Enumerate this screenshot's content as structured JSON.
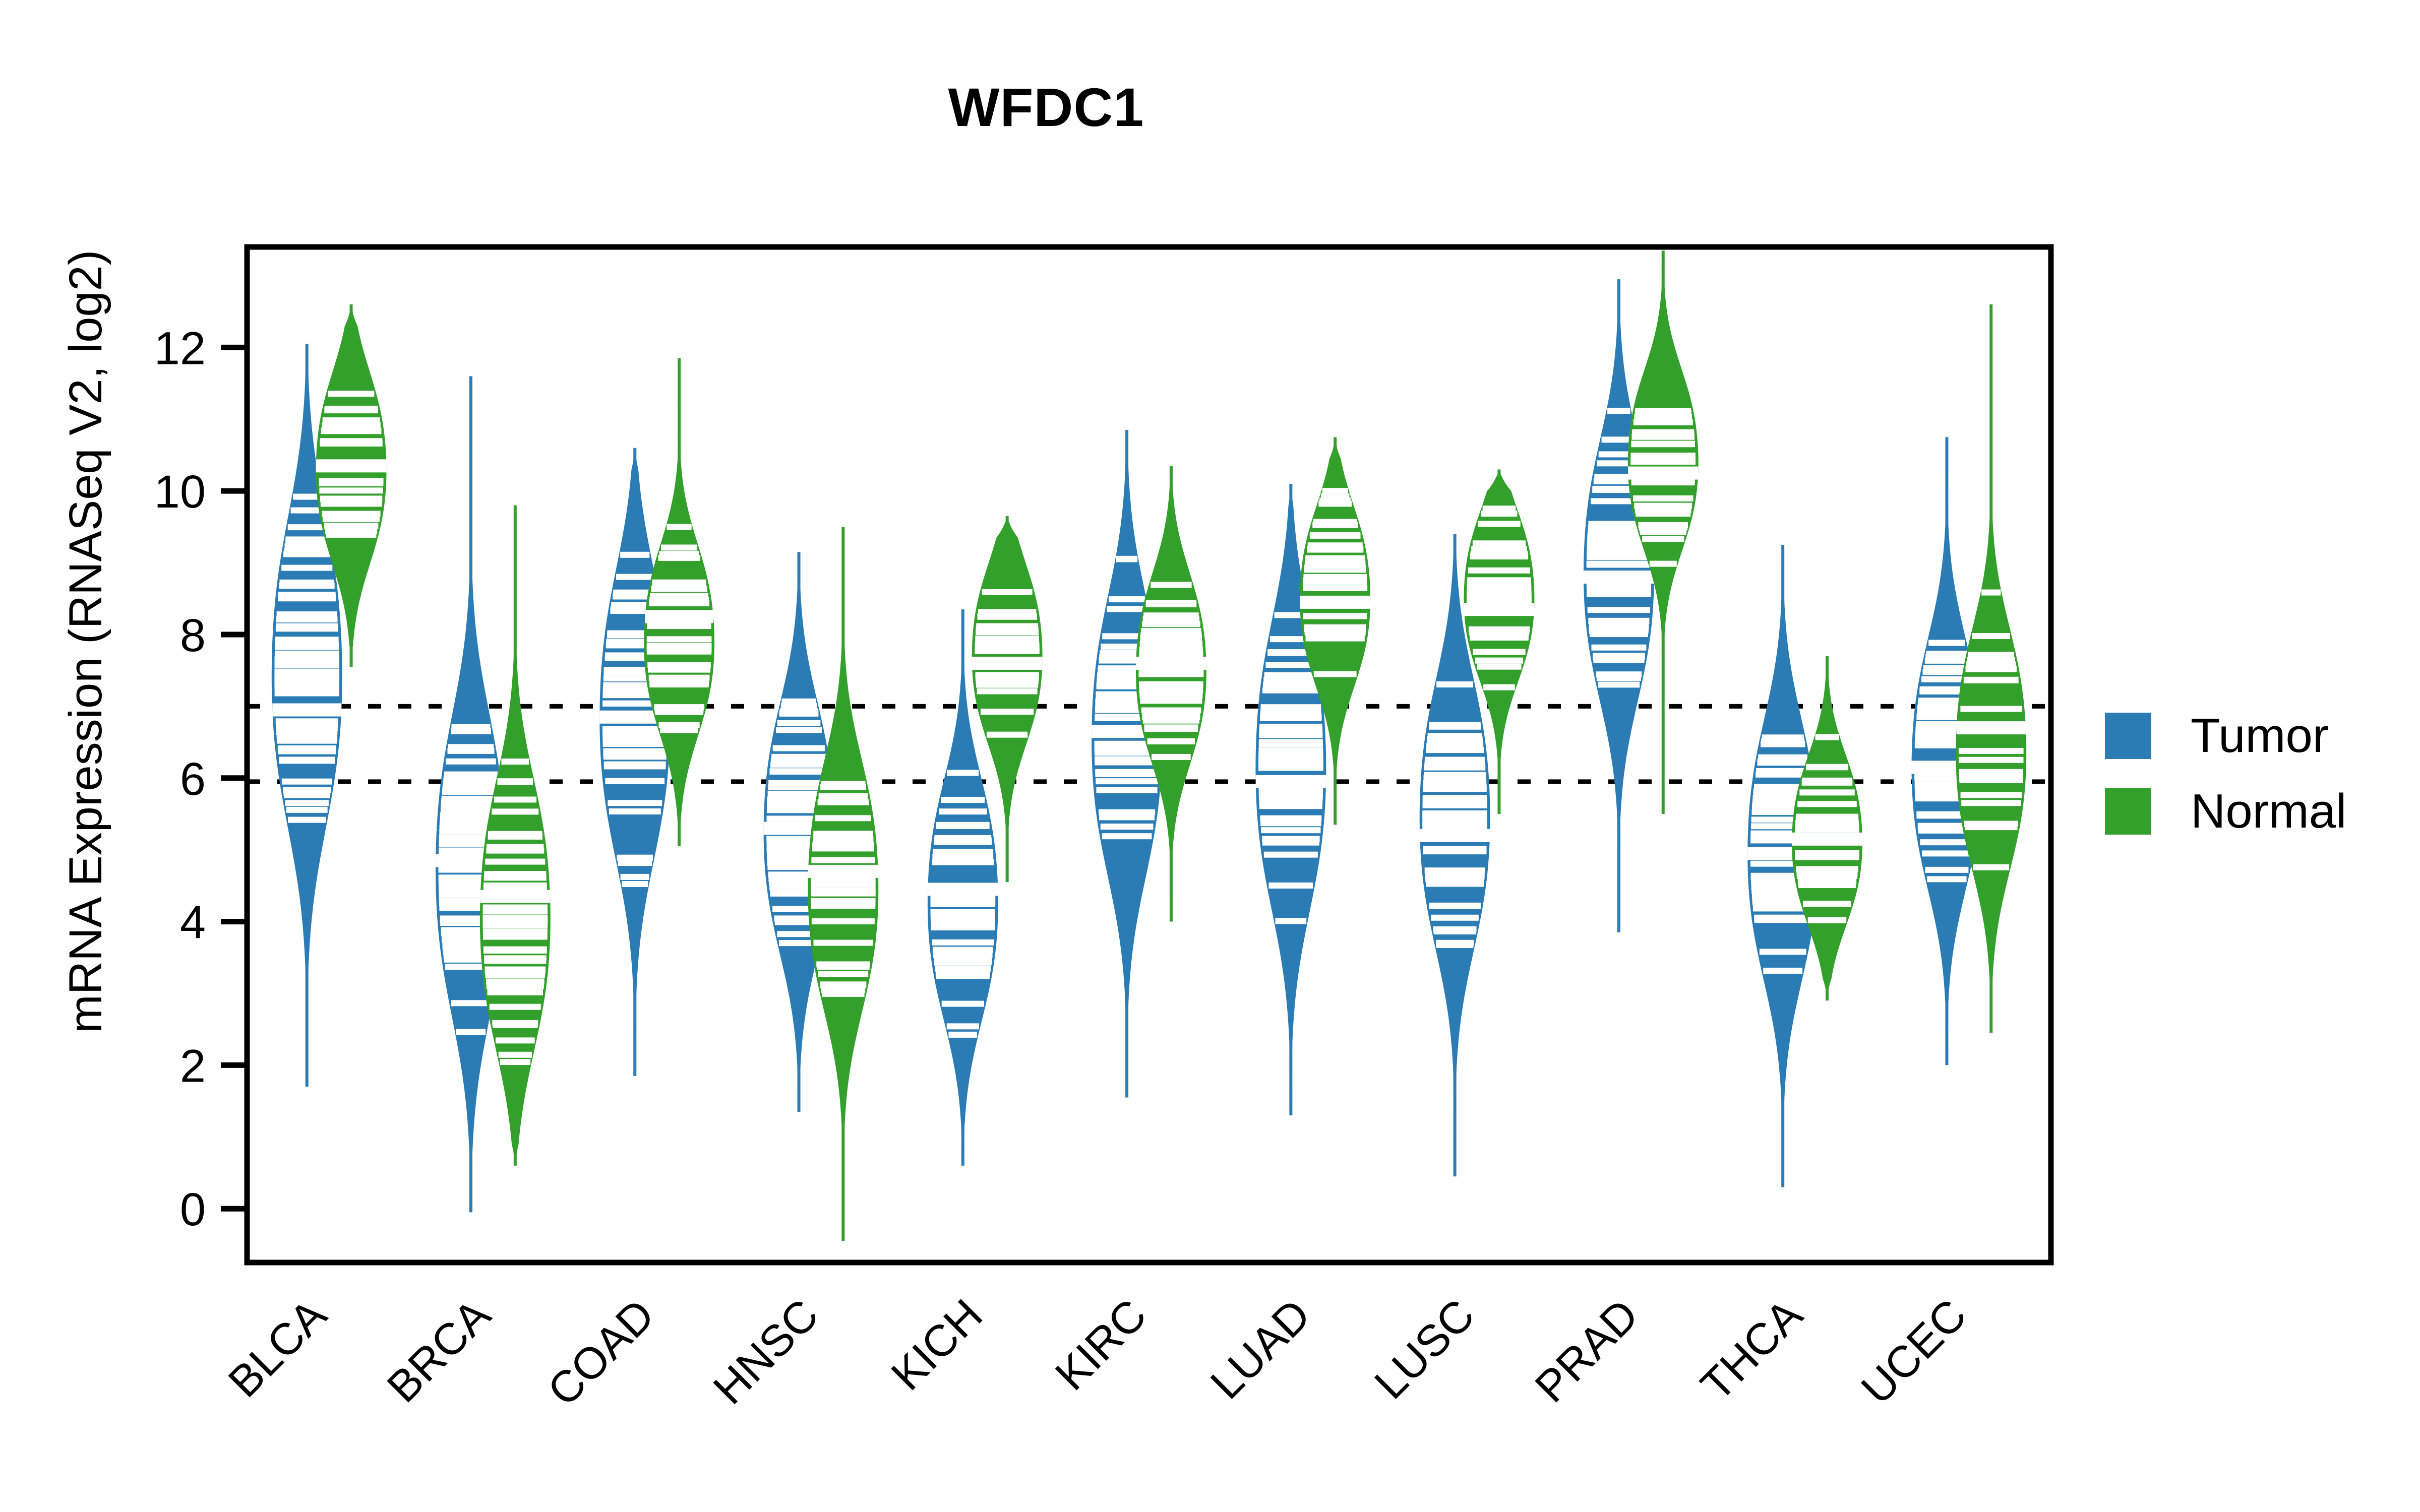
{
  "chart_data": {
    "type": "violin",
    "title": "WFDC1",
    "xlabel": "",
    "ylabel": "mRNA Expression (RNASeq V2, log2)",
    "ylim": [
      -0.75,
      13.4
    ],
    "yticks": [
      0,
      2,
      4,
      6,
      8,
      10,
      12
    ],
    "ytick_labels": [
      "0",
      "2",
      "4",
      "6",
      "8",
      "10",
      "12"
    ],
    "grid": false,
    "legend_position": "right",
    "reference_lines": [
      7.0,
      5.95
    ],
    "categories": [
      "BLCA",
      "BRCA",
      "COAD",
      "HNSC",
      "KICH",
      "KIRC",
      "LUAD",
      "LUSC",
      "PRAD",
      "THCA",
      "UCEC"
    ],
    "legend": [
      {
        "name": "Tumor",
        "color": "#2b7cb5"
      },
      {
        "name": "Normal",
        "color": "#33a02c"
      }
    ],
    "series": [
      {
        "name": "Tumor",
        "color": "#2b7cb5",
        "groups": [
          {
            "category": "BLCA",
            "median": 6.95,
            "min": 1.7,
            "max": 12.05,
            "q1": 5.45,
            "q3": 8.45,
            "mode": 7.6,
            "spread": 1.55,
            "n_ticks": 62
          },
          {
            "category": "BRCA",
            "median": 4.85,
            "min": -0.05,
            "max": 11.6,
            "q1": 3.6,
            "q3": 6.25,
            "mode": 4.9,
            "spread": 1.5,
            "n_ticks": 74
          },
          {
            "category": "COAD",
            "median": 6.85,
            "min": 1.85,
            "max": 10.6,
            "q1": 5.6,
            "q3": 8.05,
            "mode": 7.0,
            "spread": 1.45,
            "n_ticks": 60
          },
          {
            "category": "HNSC",
            "median": 5.3,
            "min": 1.35,
            "max": 9.15,
            "q1": 4.1,
            "q3": 6.1,
            "mode": 5.4,
            "spread": 1.25,
            "n_ticks": 58
          },
          {
            "category": "KICH",
            "median": 4.45,
            "min": 0.6,
            "max": 8.35,
            "q1": 3.55,
            "q3": 5.55,
            "mode": 4.4,
            "spread": 1.2,
            "n_ticks": 42
          },
          {
            "category": "KIRC",
            "median": 6.65,
            "min": 1.55,
            "max": 10.85,
            "q1": 5.45,
            "q3": 7.85,
            "mode": 6.7,
            "spread": 1.4,
            "n_ticks": 56
          },
          {
            "category": "LUAD",
            "median": 5.95,
            "min": 1.3,
            "max": 10.1,
            "q1": 4.55,
            "q3": 7.15,
            "mode": 6.3,
            "spread": 1.45,
            "n_ticks": 56
          },
          {
            "category": "LUSC",
            "median": 5.2,
            "min": 0.45,
            "max": 9.4,
            "q1": 4.05,
            "q3": 6.3,
            "mode": 5.6,
            "spread": 1.35,
            "n_ticks": 56
          },
          {
            "category": "PRAD",
            "median": 8.8,
            "min": 3.85,
            "max": 12.95,
            "q1": 7.85,
            "q3": 9.85,
            "mode": 9.0,
            "spread": 1.3,
            "n_ticks": 60
          },
          {
            "category": "THCA",
            "median": 4.95,
            "min": 0.3,
            "max": 9.25,
            "q1": 3.9,
            "q3": 6.0,
            "mode": 5.1,
            "spread": 1.3,
            "n_ticks": 58
          },
          {
            "category": "UCEC",
            "median": 6.15,
            "min": 2.0,
            "max": 10.75,
            "q1": 5.3,
            "q3": 7.25,
            "mode": 6.3,
            "spread": 1.25,
            "n_ticks": 52
          }
        ]
      },
      {
        "name": "Normal",
        "color": "#33a02c",
        "groups": [
          {
            "category": "BLCA",
            "median": 10.35,
            "min": 7.55,
            "max": 12.6,
            "q1": 9.55,
            "q3": 11.0,
            "mode": 10.4,
            "spread": 0.95,
            "n_ticks": 20
          },
          {
            "category": "BRCA",
            "median": 4.35,
            "min": 0.6,
            "max": 9.8,
            "q1": 3.25,
            "q3": 5.45,
            "mode": 4.2,
            "spread": 1.35,
            "n_ticks": 46
          },
          {
            "category": "COAD",
            "median": 8.25,
            "min": 5.05,
            "max": 11.85,
            "q1": 7.45,
            "q3": 8.85,
            "mode": 8.0,
            "spread": 0.95,
            "n_ticks": 34
          },
          {
            "category": "HNSC",
            "median": 4.7,
            "min": -0.45,
            "max": 9.5,
            "q1": 3.8,
            "q3": 5.95,
            "mode": 4.6,
            "spread": 1.25,
            "n_ticks": 34
          },
          {
            "category": "KICH",
            "median": 7.6,
            "min": 4.55,
            "max": 9.65,
            "q1": 6.85,
            "q3": 8.25,
            "mode": 7.8,
            "spread": 0.9,
            "n_ticks": 20
          },
          {
            "category": "KIRC",
            "median": 7.6,
            "min": 4.0,
            "max": 10.35,
            "q1": 6.9,
            "q3": 8.25,
            "mode": 7.6,
            "spread": 0.95,
            "n_ticks": 34
          },
          {
            "category": "LUAD",
            "median": 8.45,
            "min": 5.35,
            "max": 10.75,
            "q1": 7.75,
            "q3": 9.05,
            "mode": 8.6,
            "spread": 0.9,
            "n_ticks": 34
          },
          {
            "category": "LUSC",
            "median": 8.35,
            "min": 5.5,
            "max": 10.3,
            "q1": 7.7,
            "q3": 9.05,
            "mode": 8.6,
            "spread": 0.85,
            "n_ticks": 30
          },
          {
            "category": "PRAD",
            "median": 10.25,
            "min": 5.5,
            "max": 13.35,
            "q1": 9.6,
            "q3": 10.95,
            "mode": 10.5,
            "spread": 0.9,
            "n_ticks": 30
          },
          {
            "category": "THCA",
            "median": 5.15,
            "min": 2.9,
            "max": 7.7,
            "q1": 4.5,
            "q3": 5.8,
            "mode": 5.2,
            "spread": 0.85,
            "n_ticks": 28
          },
          {
            "category": "UCEC",
            "median": 6.7,
            "min": 2.45,
            "max": 12.6,
            "q1": 5.8,
            "q3": 8.55,
            "mode": 6.5,
            "spread": 1.2,
            "n_ticks": 24
          }
        ]
      }
    ]
  },
  "title": {
    "text": "WFDC1"
  },
  "axes": {
    "ylabel": "mRNA Expression (RNASeq V2, log2)",
    "ytick_labels": [
      "0",
      "2",
      "4",
      "6",
      "8",
      "10",
      "12"
    ],
    "xtick_labels": [
      "BLCA",
      "BRCA",
      "COAD",
      "HNSC",
      "KICH",
      "KIRC",
      "LUAD",
      "LUSC",
      "PRAD",
      "THCA",
      "UCEC"
    ]
  },
  "legend": {
    "items": [
      {
        "label": "Tumor",
        "color": "#2b7cb5"
      },
      {
        "label": "Normal",
        "color": "#33a02c"
      }
    ]
  }
}
